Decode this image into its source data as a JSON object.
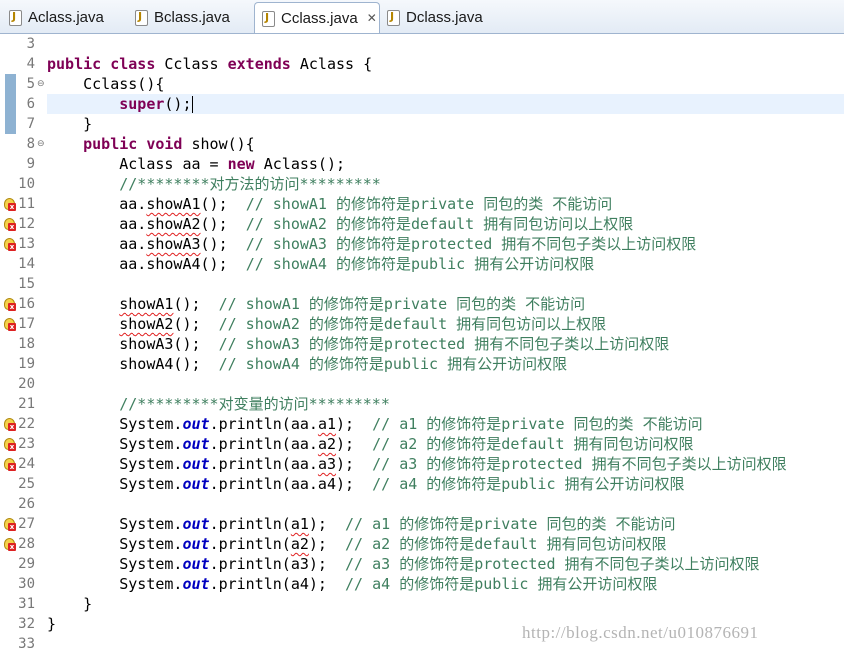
{
  "tabs": [
    {
      "label": "Aclass.java",
      "active": false
    },
    {
      "label": "Bclass.java",
      "active": false
    },
    {
      "label": "Cclass.java",
      "active": true,
      "close": "✕"
    },
    {
      "label": "Dclass.java",
      "active": false
    }
  ],
  "editor": {
    "watermark": "http://blog.csdn.net/u010876691",
    "lines": [
      {
        "n": "3",
        "seg": []
      },
      {
        "n": "4",
        "seg": [
          {
            "c": "kw",
            "t": "public"
          },
          {
            "t": " "
          },
          {
            "c": "kw",
            "t": "class"
          },
          {
            "t": " Cclass "
          },
          {
            "c": "kw",
            "t": "extends"
          },
          {
            "t": " Aclass {"
          }
        ]
      },
      {
        "n": "5",
        "fold": "⊖",
        "seg": [
          {
            "t": "    Cclass(){"
          }
        ]
      },
      {
        "n": "6",
        "seg": [
          {
            "t": "        "
          },
          {
            "c": "kw",
            "t": "super"
          },
          {
            "t": "();"
          }
        ],
        "caret": true
      },
      {
        "n": "7",
        "seg": [
          {
            "t": "    }"
          }
        ]
      },
      {
        "n": "8",
        "fold": "⊖",
        "seg": [
          {
            "t": "    "
          },
          {
            "c": "kw",
            "t": "public"
          },
          {
            "t": " "
          },
          {
            "c": "kw",
            "t": "void"
          },
          {
            "t": " show(){"
          }
        ]
      },
      {
        "n": "9",
        "seg": [
          {
            "t": "        Aclass aa = "
          },
          {
            "c": "kw",
            "t": "new"
          },
          {
            "t": " Aclass();"
          }
        ]
      },
      {
        "n": "10",
        "seg": [
          {
            "t": "        "
          },
          {
            "c": "cm",
            "t": "//********对方法的访问*********"
          }
        ]
      },
      {
        "n": "11",
        "warn": true,
        "seg": [
          {
            "t": "        aa."
          },
          {
            "c": "wav",
            "t": "showA1"
          },
          {
            "t": "();  "
          },
          {
            "c": "cm",
            "t": "// showA1 的修饰符是private 同包的类 不能访问"
          }
        ]
      },
      {
        "n": "12",
        "warn": true,
        "seg": [
          {
            "t": "        aa."
          },
          {
            "c": "wav",
            "t": "showA2"
          },
          {
            "t": "();  "
          },
          {
            "c": "cm",
            "t": "// showA2 的修饰符是default 拥有同包访问以上权限"
          }
        ]
      },
      {
        "n": "13",
        "warn": true,
        "seg": [
          {
            "t": "        aa."
          },
          {
            "c": "wav",
            "t": "showA3"
          },
          {
            "t": "();  "
          },
          {
            "c": "cm",
            "t": "// showA3 的修饰符是protected 拥有不同包子类以上访问权限"
          }
        ]
      },
      {
        "n": "14",
        "seg": [
          {
            "t": "        aa.showA4();  "
          },
          {
            "c": "cm",
            "t": "// showA4 的修饰符是public 拥有公开访问权限"
          }
        ]
      },
      {
        "n": "15",
        "seg": []
      },
      {
        "n": "16",
        "warn": true,
        "seg": [
          {
            "t": "        "
          },
          {
            "c": "wav",
            "t": "showA1"
          },
          {
            "t": "();  "
          },
          {
            "c": "cm",
            "t": "// showA1 的修饰符是private 同包的类 不能访问"
          }
        ]
      },
      {
        "n": "17",
        "warn": true,
        "seg": [
          {
            "t": "        "
          },
          {
            "c": "wav",
            "t": "showA2"
          },
          {
            "t": "();  "
          },
          {
            "c": "cm",
            "t": "// showA2 的修饰符是default 拥有同包访问以上权限"
          }
        ]
      },
      {
        "n": "18",
        "seg": [
          {
            "t": "        showA3();  "
          },
          {
            "c": "cm",
            "t": "// showA3 的修饰符是protected 拥有不同包子类以上访问权限"
          }
        ]
      },
      {
        "n": "19",
        "seg": [
          {
            "t": "        showA4();  "
          },
          {
            "c": "cm",
            "t": "// showA4 的修饰符是public 拥有公开访问权限"
          }
        ]
      },
      {
        "n": "20",
        "seg": []
      },
      {
        "n": "21",
        "seg": [
          {
            "t": "        "
          },
          {
            "c": "cm",
            "t": "//*********对变量的访问*********"
          }
        ]
      },
      {
        "n": "22",
        "warn": true,
        "seg": [
          {
            "t": "        System."
          },
          {
            "c": "fld",
            "t": "out"
          },
          {
            "t": ".println(aa."
          },
          {
            "c": "wav",
            "t": "a1"
          },
          {
            "t": ");  "
          },
          {
            "c": "cm",
            "t": "// a1 的修饰符是private 同包的类 不能访问"
          }
        ]
      },
      {
        "n": "23",
        "warn": true,
        "seg": [
          {
            "t": "        System."
          },
          {
            "c": "fld",
            "t": "out"
          },
          {
            "t": ".println(aa."
          },
          {
            "c": "wav",
            "t": "a2"
          },
          {
            "t": ");  "
          },
          {
            "c": "cm",
            "t": "// a2 的修饰符是default 拥有同包访问权限"
          }
        ]
      },
      {
        "n": "24",
        "warn": true,
        "seg": [
          {
            "t": "        System."
          },
          {
            "c": "fld",
            "t": "out"
          },
          {
            "t": ".println(aa."
          },
          {
            "c": "wav",
            "t": "a3"
          },
          {
            "t": ");  "
          },
          {
            "c": "cm",
            "t": "// a3 的修饰符是protected 拥有不同包子类以上访问权限"
          }
        ]
      },
      {
        "n": "25",
        "seg": [
          {
            "t": "        System."
          },
          {
            "c": "fld",
            "t": "out"
          },
          {
            "t": ".println(aa.a4);  "
          },
          {
            "c": "cm",
            "t": "// a4 的修饰符是public 拥有公开访问权限"
          }
        ]
      },
      {
        "n": "26",
        "seg": []
      },
      {
        "n": "27",
        "warn": true,
        "seg": [
          {
            "t": "        System."
          },
          {
            "c": "fld",
            "t": "out"
          },
          {
            "t": ".println("
          },
          {
            "c": "wav",
            "t": "a1"
          },
          {
            "t": ");  "
          },
          {
            "c": "cm",
            "t": "// a1 的修饰符是private 同包的类 不能访问"
          }
        ]
      },
      {
        "n": "28",
        "warn": true,
        "seg": [
          {
            "t": "        System."
          },
          {
            "c": "fld",
            "t": "out"
          },
          {
            "t": ".println("
          },
          {
            "c": "wav",
            "t": "a2"
          },
          {
            "t": ");  "
          },
          {
            "c": "cm",
            "t": "// a2 的修饰符是default 拥有同包访问权限"
          }
        ]
      },
      {
        "n": "29",
        "seg": [
          {
            "t": "        System."
          },
          {
            "c": "fld",
            "t": "out"
          },
          {
            "t": ".println(a3);  "
          },
          {
            "c": "cm",
            "t": "// a3 的修饰符是protected 拥有不同包子类以上访问权限"
          }
        ]
      },
      {
        "n": "30",
        "seg": [
          {
            "t": "        System."
          },
          {
            "c": "fld",
            "t": "out"
          },
          {
            "t": ".println(a4);  "
          },
          {
            "c": "cm",
            "t": "// a4 的修饰符是public 拥有公开访问权限"
          }
        ]
      },
      {
        "n": "31",
        "seg": [
          {
            "t": "    }"
          }
        ]
      },
      {
        "n": "32",
        "seg": [
          {
            "t": "}"
          }
        ]
      },
      {
        "n": "33",
        "seg": []
      }
    ]
  },
  "colors": {
    "keyword": "#7f0055",
    "comment": "#3f7f5f",
    "field": "#0000c0",
    "current_line": "#e8f2fe",
    "change_marker": "#8eb2d2"
  }
}
